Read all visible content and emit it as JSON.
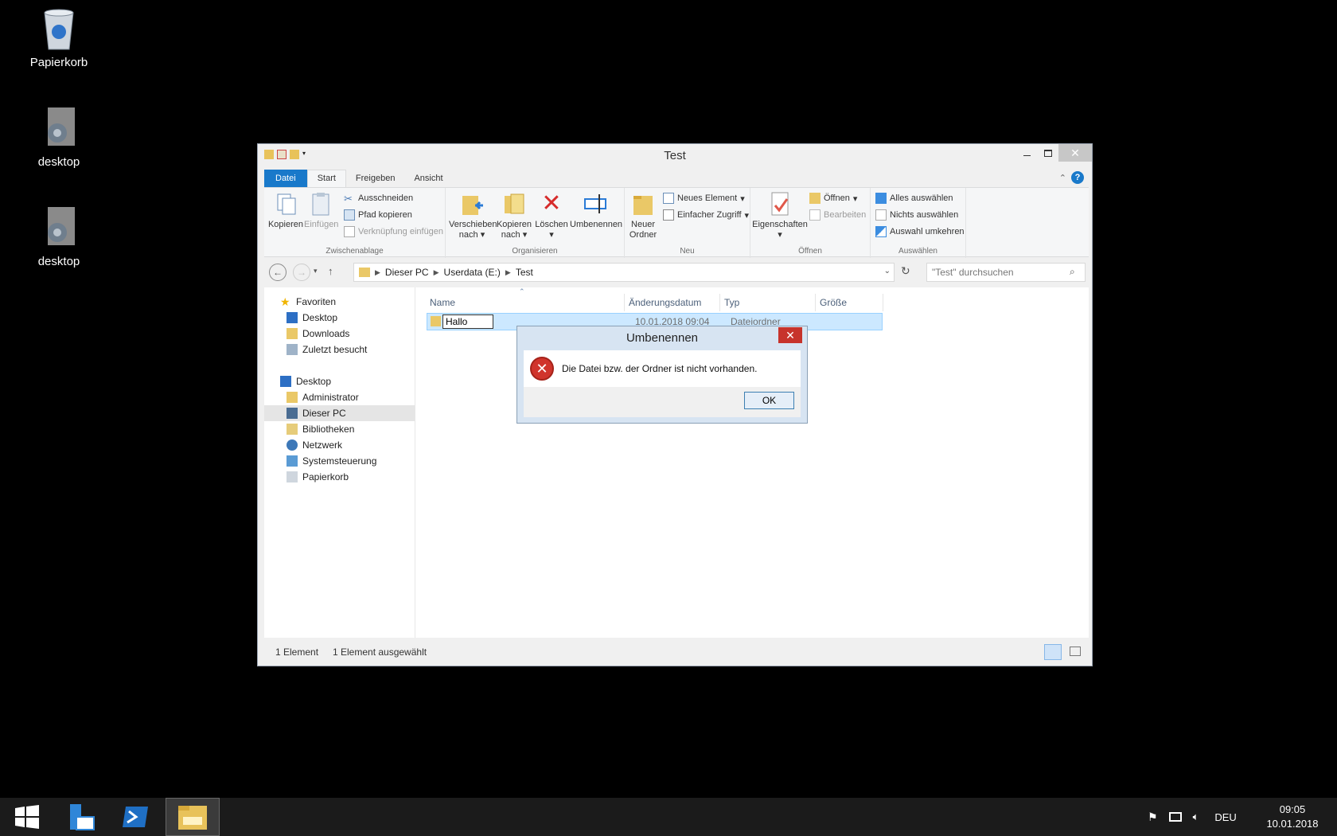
{
  "desktop": {
    "icons": [
      {
        "label": "Papierkorb"
      },
      {
        "label": "desktop"
      },
      {
        "label": "desktop"
      }
    ]
  },
  "window": {
    "title": "Test",
    "tabs": [
      "Datei",
      "Start",
      "Freigeben",
      "Ansicht"
    ],
    "ribbon": {
      "clipboard": {
        "label": "Zwischenablage",
        "copy": "Kopieren",
        "paste": "Einfügen",
        "cut": "Ausschneiden",
        "copy_path": "Pfad kopieren",
        "paste_shortcut": "Verknüpfung einfügen"
      },
      "organize": {
        "label": "Organisieren",
        "move_to_1": "Verschieben",
        "move_to_2": "nach",
        "copy_to_1": "Kopieren",
        "copy_to_2": "nach",
        "delete": "Löschen",
        "rename": "Umbenennen"
      },
      "new": {
        "label": "Neu",
        "new_folder_1": "Neuer",
        "new_folder_2": "Ordner",
        "new_item": "Neues Element",
        "easy_access": "Einfacher Zugriff"
      },
      "open": {
        "label": "Öffnen",
        "properties": "Eigenschaften",
        "open": "Öffnen",
        "edit": "Bearbeiten"
      },
      "select": {
        "label": "Auswählen",
        "select_all": "Alles auswählen",
        "select_none": "Nichts auswählen",
        "invert": "Auswahl umkehren"
      }
    },
    "address": {
      "segments": [
        "Dieser PC",
        "Userdata (E:)",
        "Test"
      ],
      "search_placeholder": "\"Test\" durchsuchen"
    },
    "nav": {
      "favorites": "Favoriten",
      "items_fav": [
        "Desktop",
        "Downloads",
        "Zuletzt besucht"
      ],
      "desktop": "Desktop",
      "items_desk": [
        "Administrator",
        "Dieser PC",
        "Bibliotheken",
        "Netzwerk",
        "Systemsteuerung",
        "Papierkorb"
      ]
    },
    "columns": {
      "name": "Name",
      "date": "Änderungsdatum",
      "type": "Typ",
      "size": "Größe"
    },
    "rows": [
      {
        "name": "Hallo",
        "date": "10.01.2018 09:04",
        "type": "Dateiordner"
      }
    ],
    "status": {
      "count": "1 Element",
      "selected": "1 Element ausgewählt"
    }
  },
  "dialog": {
    "title": "Umbenennen",
    "message": "Die Datei bzw. der Ordner ist nicht vorhanden.",
    "ok": "OK"
  },
  "taskbar": {
    "lang": "DEU",
    "time": "09:05",
    "date": "10.01.2018"
  }
}
